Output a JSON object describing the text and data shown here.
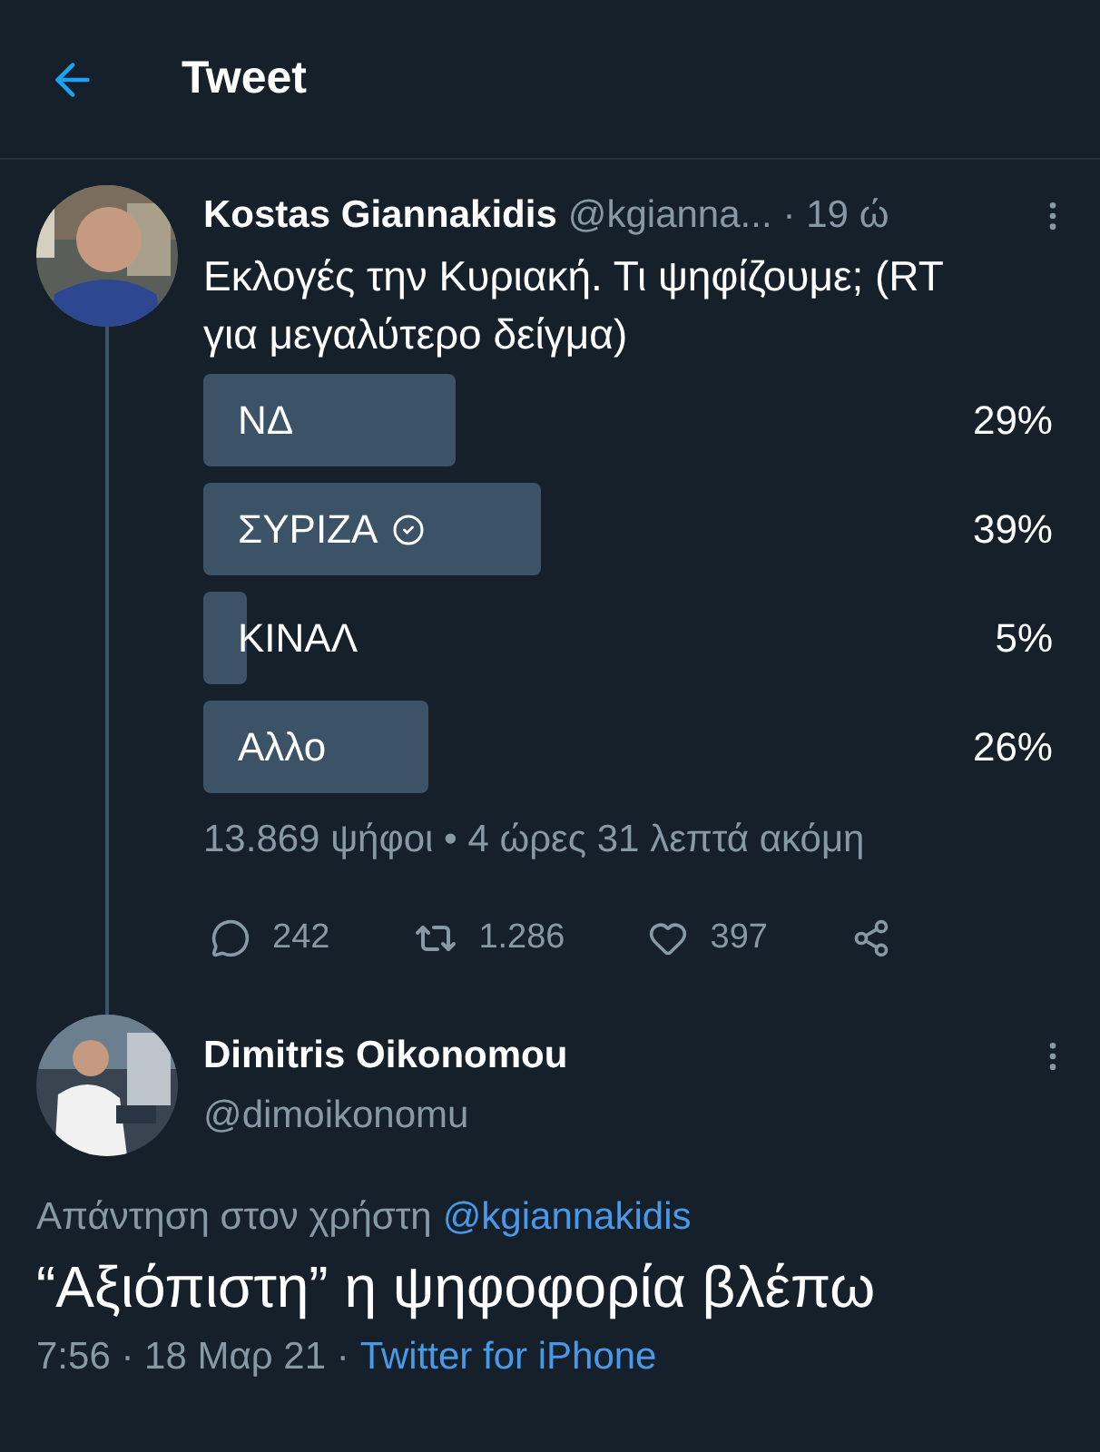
{
  "header": {
    "title": "Tweet"
  },
  "tweet": {
    "name": "Kostas Giannakidis",
    "handle": "@kgianna...",
    "time": "· 19 ώ",
    "text": "Εκλογές την Κυριακή. Τι ψηφίζουμε; (RT για μεγαλύτερο δείγμα)",
    "poll": {
      "options": [
        {
          "label": "ΝΔ",
          "percent": "29%",
          "voted": false
        },
        {
          "label": "ΣΥΡΙΖΑ",
          "percent": "39%",
          "voted": true
        },
        {
          "label": "ΚΙΝΑΛ",
          "percent": "5%",
          "voted": false
        },
        {
          "label": "Αλλο",
          "percent": "26%",
          "voted": false
        }
      ],
      "summary": "13.869 ψήφοι • 4 ώρες 31 λεπτά ακόμη"
    },
    "actions": {
      "replies": "242",
      "retweets": "1.286",
      "likes": "397"
    }
  },
  "reply": {
    "name": "Dimitris Oikonomou",
    "handle": "@dimoikonomu",
    "reply_to": "Απάντηση στον χρήστη",
    "reply_to_handle": "@kgiannakidis",
    "text": "“Αξιόπιστη” η ψηφοφορία βλέπω",
    "time": "7:56 · 18 Μαρ 21 ·",
    "source": "Twitter for iPhone"
  }
}
